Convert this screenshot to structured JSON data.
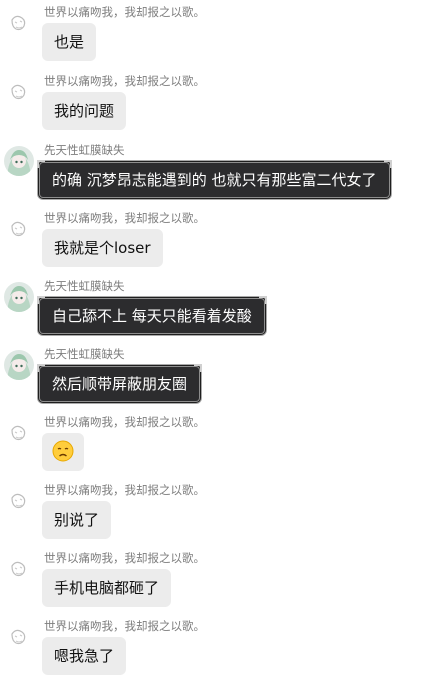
{
  "users": {
    "a": {
      "name": "世界以痛吻我，我却报之以歌。",
      "avatar_icon": "sketch-avatar-icon"
    },
    "b": {
      "name": "先天性虹膜缺失",
      "avatar_icon": "anime-girl-avatar-icon"
    }
  },
  "messages": [
    {
      "name": "世界以痛吻我，我却报之以歌。",
      "text": "也是"
    },
    {
      "name": "世界以痛吻我，我却报之以歌。",
      "text": "我的问题"
    },
    {
      "name": "先天性虹膜缺失",
      "text": "的确 沉梦昂志能遇到的 也就只有那些富二代女了"
    },
    {
      "name": "世界以痛吻我，我却报之以歌。",
      "text": "我就是个loser"
    },
    {
      "name": "先天性虹膜缺失",
      "text": "自己舔不上 每天只能看着发酸"
    },
    {
      "name": "先天性虹膜缺失",
      "text": "然后顺带屏蔽朋友圈"
    },
    {
      "name": "世界以痛吻我，我却报之以歌。",
      "emoji": "sad-face-emoji"
    },
    {
      "name": "世界以痛吻我，我却报之以歌。",
      "text": "别说了"
    },
    {
      "name": "世界以痛吻我，我却报之以歌。",
      "text": "手机电脑都砸了"
    },
    {
      "name": "世界以痛吻我，我却报之以歌。",
      "text": "嗯我急了"
    }
  ]
}
